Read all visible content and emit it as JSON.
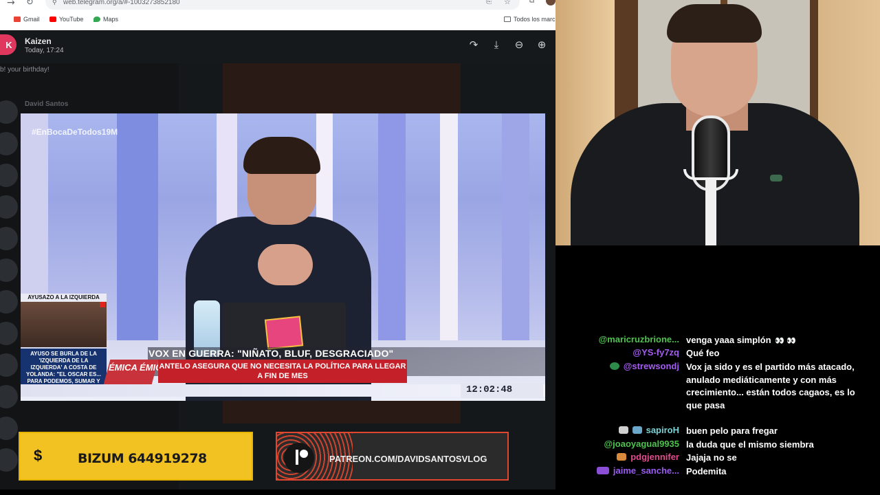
{
  "browser": {
    "url": "web.telegram.org/a/#-1003273852180",
    "bookmarks": [
      "Gmail",
      "YouTube",
      "Maps"
    ],
    "bookmarks_right": "Todos los marc"
  },
  "telegram": {
    "avatar_letter": "K",
    "sender": "Kaizen",
    "date": "Today, 17:24",
    "preview": "b! your birthday!",
    "chat_name": "David Santos"
  },
  "video": {
    "hashtag": "#EnBocaDeTodos19M",
    "inset_label": "AYUSAZO A LA IZQUIERDA",
    "inset_caption": "AYUSO SE BURLA DE LA 'IZQUIERDA DE LA IZQUIERDA' A COSTA DE YOLANDA: \"EL OSCAR ES... PARA PODEMOS, SUMAR Y HAMÁS MADRID\"",
    "side_text": "ÉMICA ÉMICA",
    "headline": "VOX EN GUERRA: \"NIÑATO, BLUF, DESGRACIADO\"",
    "subline": "ANTELO ASEGURA QUE NO NECESITA LA POLÍTICA PARA LLEGAR A FIN DE MES",
    "clock": "12:02:48"
  },
  "banners": {
    "bizum": "BIZUM 644919278",
    "patreon": "PATREON.COM/DAVIDSANTOSVLOG"
  },
  "chat": [
    {
      "user": "@maricruzbrione...",
      "color": "#4fc24f",
      "badges": [],
      "message": "venga yaaa simplón",
      "emote": "👀 👀"
    },
    {
      "user": "@YS-fy7zq",
      "color": "#a55cf2",
      "badges": [],
      "message": "Qué feo"
    },
    {
      "user": "@strewsondj",
      "color": "#a55cf2",
      "badges": [
        "#2d8c4a"
      ],
      "message": "Vox ja sido y es el partido más atacado, anulado mediáticamente y con más crecimiento... están todos cagaos, es lo que pasa"
    },
    {
      "user": "sapiroH",
      "color": "#7bd3d6",
      "badges": [
        "#cfcfcf",
        "#6aa7c9"
      ],
      "message": "buen pelo para fregar"
    },
    {
      "user": "@joaoyagual9935",
      "color": "#4fc24f",
      "badges": [],
      "message": "la duda que el mismo siembra"
    },
    {
      "user": "pdgjennifer",
      "color": "#e24b8d",
      "badges": [
        "#d98a3a"
      ],
      "message": "Jajaja no se"
    },
    {
      "user": "jaime_sanche...",
      "color": "#9a5cf2",
      "badges": [
        "#8a4fd6"
      ],
      "message": "Podemita"
    }
  ]
}
